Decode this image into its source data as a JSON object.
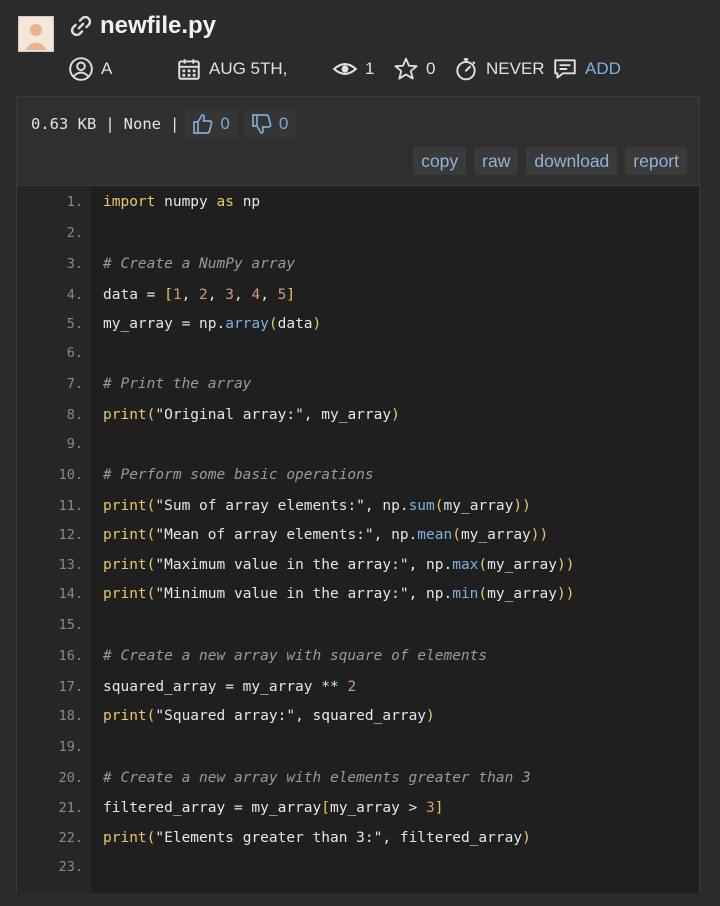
{
  "paste": {
    "title": "newfile.py",
    "author": "A",
    "date": "AUG 5TH,",
    "views": "1",
    "stars": "0",
    "expiry": "NEVER",
    "add_comment": "ADD"
  },
  "info": {
    "size": "0.63 KB",
    "separator": "|",
    "syntax": "None",
    "likes": "0",
    "dislikes": "0"
  },
  "actions": {
    "copy": "copy",
    "raw": "raw",
    "download": "download",
    "report": "report"
  },
  "code_lines": [
    [
      [
        "kw",
        "import"
      ],
      [
        "t",
        " numpy "
      ],
      [
        "kw",
        "as"
      ],
      [
        "t",
        " np"
      ]
    ],
    [],
    [
      [
        "cm",
        "# Create a NumPy array"
      ]
    ],
    [
      [
        "t",
        "data = "
      ],
      [
        "kw",
        "["
      ],
      [
        "num",
        "1"
      ],
      [
        "t",
        ", "
      ],
      [
        "num",
        "2"
      ],
      [
        "t",
        ", "
      ],
      [
        "num",
        "3"
      ],
      [
        "t",
        ", "
      ],
      [
        "num",
        "4"
      ],
      [
        "t",
        ", "
      ],
      [
        "num",
        "5"
      ],
      [
        "kw",
        "]"
      ]
    ],
    [
      [
        "t",
        "my_array = np."
      ],
      [
        "method",
        "array"
      ],
      [
        "kw",
        "("
      ],
      [
        "t",
        "data"
      ],
      [
        "kw",
        ")"
      ]
    ],
    [],
    [
      [
        "cm",
        "# Print the array"
      ]
    ],
    [
      [
        "fn",
        "print"
      ],
      [
        "kw",
        "("
      ],
      [
        "str",
        "\"Original array:\""
      ],
      [
        "t",
        ", my_array"
      ],
      [
        "kw",
        ")"
      ]
    ],
    [],
    [
      [
        "cm",
        "# Perform some basic operations"
      ]
    ],
    [
      [
        "fn",
        "print"
      ],
      [
        "kw",
        "("
      ],
      [
        "str",
        "\"Sum of array elements:\""
      ],
      [
        "t",
        ", np."
      ],
      [
        "method",
        "sum"
      ],
      [
        "kw",
        "("
      ],
      [
        "t",
        "my_array"
      ],
      [
        "kw",
        "))"
      ]
    ],
    [
      [
        "fn",
        "print"
      ],
      [
        "kw",
        "("
      ],
      [
        "str",
        "\"Mean of array elements:\""
      ],
      [
        "t",
        ", np."
      ],
      [
        "method",
        "mean"
      ],
      [
        "kw",
        "("
      ],
      [
        "t",
        "my_array"
      ],
      [
        "kw",
        "))"
      ]
    ],
    [
      [
        "fn",
        "print"
      ],
      [
        "kw",
        "("
      ],
      [
        "str",
        "\"Maximum value in the array:\""
      ],
      [
        "t",
        ", np."
      ],
      [
        "method",
        "max"
      ],
      [
        "kw",
        "("
      ],
      [
        "t",
        "my_array"
      ],
      [
        "kw",
        "))"
      ]
    ],
    [
      [
        "fn",
        "print"
      ],
      [
        "kw",
        "("
      ],
      [
        "str",
        "\"Minimum value in the array:\""
      ],
      [
        "t",
        ", np."
      ],
      [
        "method",
        "min"
      ],
      [
        "kw",
        "("
      ],
      [
        "t",
        "my_array"
      ],
      [
        "kw",
        "))"
      ]
    ],
    [],
    [
      [
        "cm",
        "# Create a new array with square of elements"
      ]
    ],
    [
      [
        "t",
        "squared_array = my_array ** "
      ],
      [
        "num",
        "2"
      ]
    ],
    [
      [
        "fn",
        "print"
      ],
      [
        "kw",
        "("
      ],
      [
        "str",
        "\"Squared array:\""
      ],
      [
        "t",
        ", squared_array"
      ],
      [
        "kw",
        ")"
      ]
    ],
    [],
    [
      [
        "cm",
        "# Create a new array with elements greater than 3"
      ]
    ],
    [
      [
        "t",
        "filtered_array = my_array"
      ],
      [
        "kw",
        "["
      ],
      [
        "t",
        "my_array > "
      ],
      [
        "num",
        "3"
      ],
      [
        "kw",
        "]"
      ]
    ],
    [
      [
        "fn",
        "print"
      ],
      [
        "kw",
        "("
      ],
      [
        "str",
        "\"Elements greater than 3:\""
      ],
      [
        "t",
        ", filtered_array"
      ],
      [
        "kw",
        ")"
      ]
    ],
    []
  ],
  "icons": {
    "link": "link-icon",
    "user": "user-icon",
    "calendar": "calendar-icon",
    "eye": "eye-icon",
    "star": "star-icon",
    "timer": "timer-icon",
    "comment": "comment-icon",
    "thumbs_up": "thumbs-up-icon",
    "thumbs_down": "thumbs-down-icon"
  },
  "colors": {
    "link_accent": "#7fb0df",
    "keyword": "#e8c86a",
    "number": "#d29a7a",
    "comment": "#9a9a9a"
  }
}
